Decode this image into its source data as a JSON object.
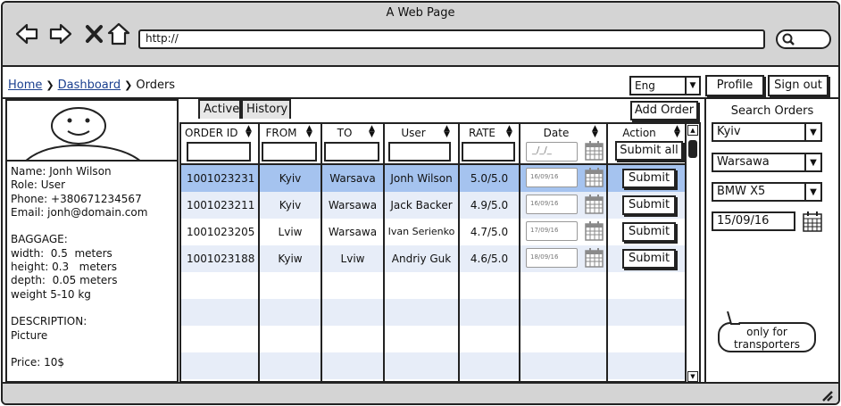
{
  "window": {
    "title": "A Web Page"
  },
  "browser": {
    "url": "http://"
  },
  "breadcrumb": {
    "home": "Home",
    "dashboard": "Dashboard",
    "current": "Orders"
  },
  "header": {
    "language": "Eng",
    "profile": "Profile",
    "sign_out": "Sign out"
  },
  "user_info": {
    "text": "Name: Jonh Wilson\nRole: User\nPhone: +380671234567\nEmail: jonh@domain.com\n\nBAGGAGE:\nwidth:  0.5  meters\nheight: 0.3   meters\ndepth:  0.05 meters\nweight 5-10 kg\n\nDESCRIPTION:\nPicture\n\nPrice: 10$"
  },
  "tabs": {
    "active": "Active",
    "history": "History"
  },
  "toolbar": {
    "add_order": "Add Order",
    "submit_all": "Submit all"
  },
  "table": {
    "headers": [
      "ORDER ID",
      "FROM",
      "TO",
      "User",
      "RATE",
      "Date",
      "Action"
    ],
    "date_placeholder": "_/_/_",
    "rows": [
      {
        "id": "1001023231",
        "from": "Kyiv",
        "to": "Warsava",
        "user": "Jonh Wilson",
        "rate": "5.0/5.0",
        "date": "16/09/16",
        "action": "Submit"
      },
      {
        "id": "1001023211",
        "from": "Kyiv",
        "to": "Warsawa",
        "user": "Jack Backer",
        "rate": "4.9/5.0",
        "date": "16/09/16",
        "action": "Submit"
      },
      {
        "id": "1001023205",
        "from": "Lviw",
        "to": "Warsawa",
        "user": "Ivan Serienko",
        "rate": "4.7/5.0",
        "date": "17/09/16",
        "action": "Submit"
      },
      {
        "id": "1001023188",
        "from": "Kyiw",
        "to": "Lviw",
        "user": "Andriy Guk",
        "rate": "4.6/5.0",
        "date": "18/09/16",
        "action": "Submit"
      }
    ]
  },
  "search_orders": {
    "title": "Search Orders",
    "from": "Kyiv",
    "to": "Warsawa",
    "vehicle": "BMW X5",
    "date": "15/09/16",
    "note": "only for transporters"
  },
  "colors": {
    "chrome": "#d4d4d4",
    "selected_row": "#a5c3ef",
    "alt_row": "#e7edf8",
    "link": "#1a3f8f"
  }
}
